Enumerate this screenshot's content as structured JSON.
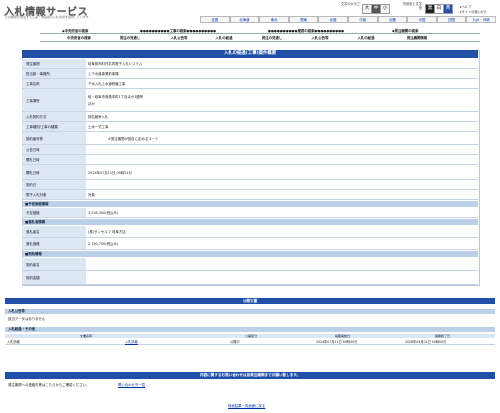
{
  "header": {
    "title": "入札情報サービス",
    "subtitle": "公共機関の発注する工事・物品等の入札情報を提供しています",
    "font_size_label": "文字の大きさ",
    "font_sizes": [
      "大",
      "中",
      "小"
    ],
    "font_size_selected": "中",
    "bg_color_label": "背景色と文字色",
    "colors": [
      "黒",
      "白",
      "青"
    ],
    "help_links": [
      "ヘルプ",
      "サイトの使いかた"
    ]
  },
  "regions": [
    "全国",
    "北海道",
    "東北",
    "関東",
    "北陸",
    "中部",
    "近畿",
    "中国",
    "四国",
    "九州・沖縄"
  ],
  "nav": {
    "groups": [
      "中央府省の検索",
      "工事の検索",
      "業務の検索",
      "発注機関の検索"
    ],
    "links": [
      "中央府省の検索",
      "発注の見通し",
      "入札公告等",
      "入札の経過",
      "発注の見通し",
      "入札公告等",
      "入札の経過",
      "発注機関情報"
    ]
  },
  "main": {
    "title": "入札の経過(工事)案件概要",
    "rows": [
      {
        "label": "発注機関",
        "value": "岐阜県市町村共同電子入札システム"
      },
      {
        "label": "担当部・事務所",
        "value": "上下水道事業前事課"
      },
      {
        "label": "工事名称",
        "value": "下水入札上水道修繕工事"
      },
      {
        "label": "工事場所",
        "value": "岐・岐阜市券昌本町1丁目ほか3箇所"
      },
      {
        "label": "",
        "value": "ほか"
      },
      {
        "label": "入札契約方式",
        "value": "指名競争入札"
      },
      {
        "label": "工事種別/工事の種類",
        "value": "土木一式工事"
      },
      {
        "label": "契約番号等",
        "value": "※発注機関が独自に定めるコード"
      },
      {
        "label": "公告日時",
        "value": ""
      },
      {
        "label": "開札日時",
        "value": ""
      },
      {
        "label": "開札日時",
        "value": "2024年07月11日 09時31分"
      },
      {
        "label": "契約日",
        "value": ""
      },
      {
        "label": "電子入札対象",
        "value": "対象"
      }
    ],
    "group_estimate": "■予定価格情報",
    "estimate_rows": [
      {
        "label": "予定価格",
        "value": "3,238,300(税込み)"
      }
    ],
    "group_winner": "■落札者情報",
    "winner_rows": [
      {
        "label": "落札者名",
        "value": "(株)サンセルフ 岐阜方店"
      },
      {
        "label": "落札価格",
        "value": "2,790,700(税込み)"
      }
    ],
    "group_contract": "■契約情報",
    "contract_rows": [
      {
        "label": "契約者名",
        "value": ""
      },
      {
        "label": "契約金額",
        "value": ""
      }
    ]
  },
  "documents": {
    "title": "公開文書",
    "sub_title": "入札公告等",
    "note": "該当データはありません",
    "history_title": "入札経過・その他",
    "columns": [
      "",
      "文書名称",
      "公開区分",
      "掲載開始日",
      "掲載終了日"
    ],
    "row": [
      "入札情報",
      "入札情報",
      "公開中",
      "2024年07月11日 09時40分",
      "2026年04月01日 00時00分"
    ]
  },
  "inquiry": {
    "title": "内容に関するお問い合わせは各発注機関までお願い致します。",
    "contact_label": "発注機関への連絡先等はこちらからご確認ください。",
    "contact_value": "問い合わせ先一覧"
  },
  "footer": {
    "back_link": "検索結果一覧画面に戻る"
  }
}
